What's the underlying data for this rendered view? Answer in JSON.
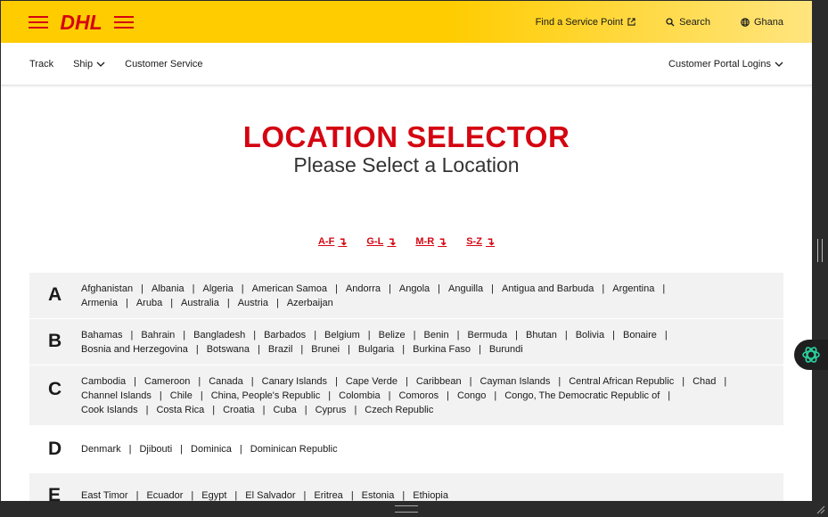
{
  "brand": {
    "logo_text": "DHL",
    "colors": {
      "yellow": "#ffcc00",
      "red": "#d40511"
    }
  },
  "topbar": {
    "service_point": {
      "label": "Find a Service Point",
      "icon": "external-link-icon"
    },
    "search": {
      "label": "Search",
      "icon": "search-icon"
    },
    "country": {
      "label": "Ghana",
      "icon": "globe-icon"
    }
  },
  "nav": {
    "track": "Track",
    "ship": "Ship",
    "customer_service": "Customer Service",
    "portal_logins": "Customer Portal Logins"
  },
  "heading": {
    "title": "LOCATION SELECTOR",
    "subtitle": "Please Select a Location"
  },
  "alpha_nav": [
    {
      "label": "A-F",
      "icon": "arrow-down-icon"
    },
    {
      "label": "G-L",
      "icon": "arrow-down-icon"
    },
    {
      "label": "M-R",
      "icon": "arrow-down-icon"
    },
    {
      "label": "S-Z",
      "icon": "arrow-down-icon"
    }
  ],
  "groups": [
    {
      "letter": "A",
      "lines": [
        [
          "Afghanistan",
          "Albania",
          "Algeria",
          "American Samoa",
          "Andorra",
          "Angola",
          "Anguilla",
          "Antigua and Barbuda",
          "Argentina"
        ],
        [
          "Armenia",
          "Aruba",
          "Australia",
          "Austria",
          "Azerbaijan"
        ]
      ]
    },
    {
      "letter": "B",
      "lines": [
        [
          "Bahamas",
          "Bahrain",
          "Bangladesh",
          "Barbados",
          "Belgium",
          "Belize",
          "Benin",
          "Bermuda",
          "Bhutan",
          "Bolivia",
          "Bonaire"
        ],
        [
          "Bosnia and Herzegovina",
          "Botswana",
          "Brazil",
          "Brunei",
          "Bulgaria",
          "Burkina Faso",
          "Burundi"
        ]
      ]
    },
    {
      "letter": "C",
      "lines": [
        [
          "Cambodia",
          "Cameroon",
          "Canada",
          "Canary Islands",
          "Cape Verde",
          "Caribbean",
          "Cayman Islands",
          "Central African Republic",
          "Chad"
        ],
        [
          "Channel Islands",
          "Chile",
          "China, People's Republic",
          "Colombia",
          "Comoros",
          "Congo",
          "Congo, The Democratic Republic of"
        ],
        [
          "Cook Islands",
          "Costa Rica",
          "Croatia",
          "Cuba",
          "Cyprus",
          "Czech Republic"
        ]
      ]
    },
    {
      "letter": "D",
      "lines": [
        [
          "Denmark",
          "Djibouti",
          "Dominica",
          "Dominican Republic"
        ]
      ]
    },
    {
      "letter": "E",
      "lines": [
        [
          "East Timor",
          "Ecuador",
          "Egypt",
          "El Salvador",
          "Eritrea",
          "Estonia",
          "Ethiopia"
        ]
      ]
    }
  ]
}
